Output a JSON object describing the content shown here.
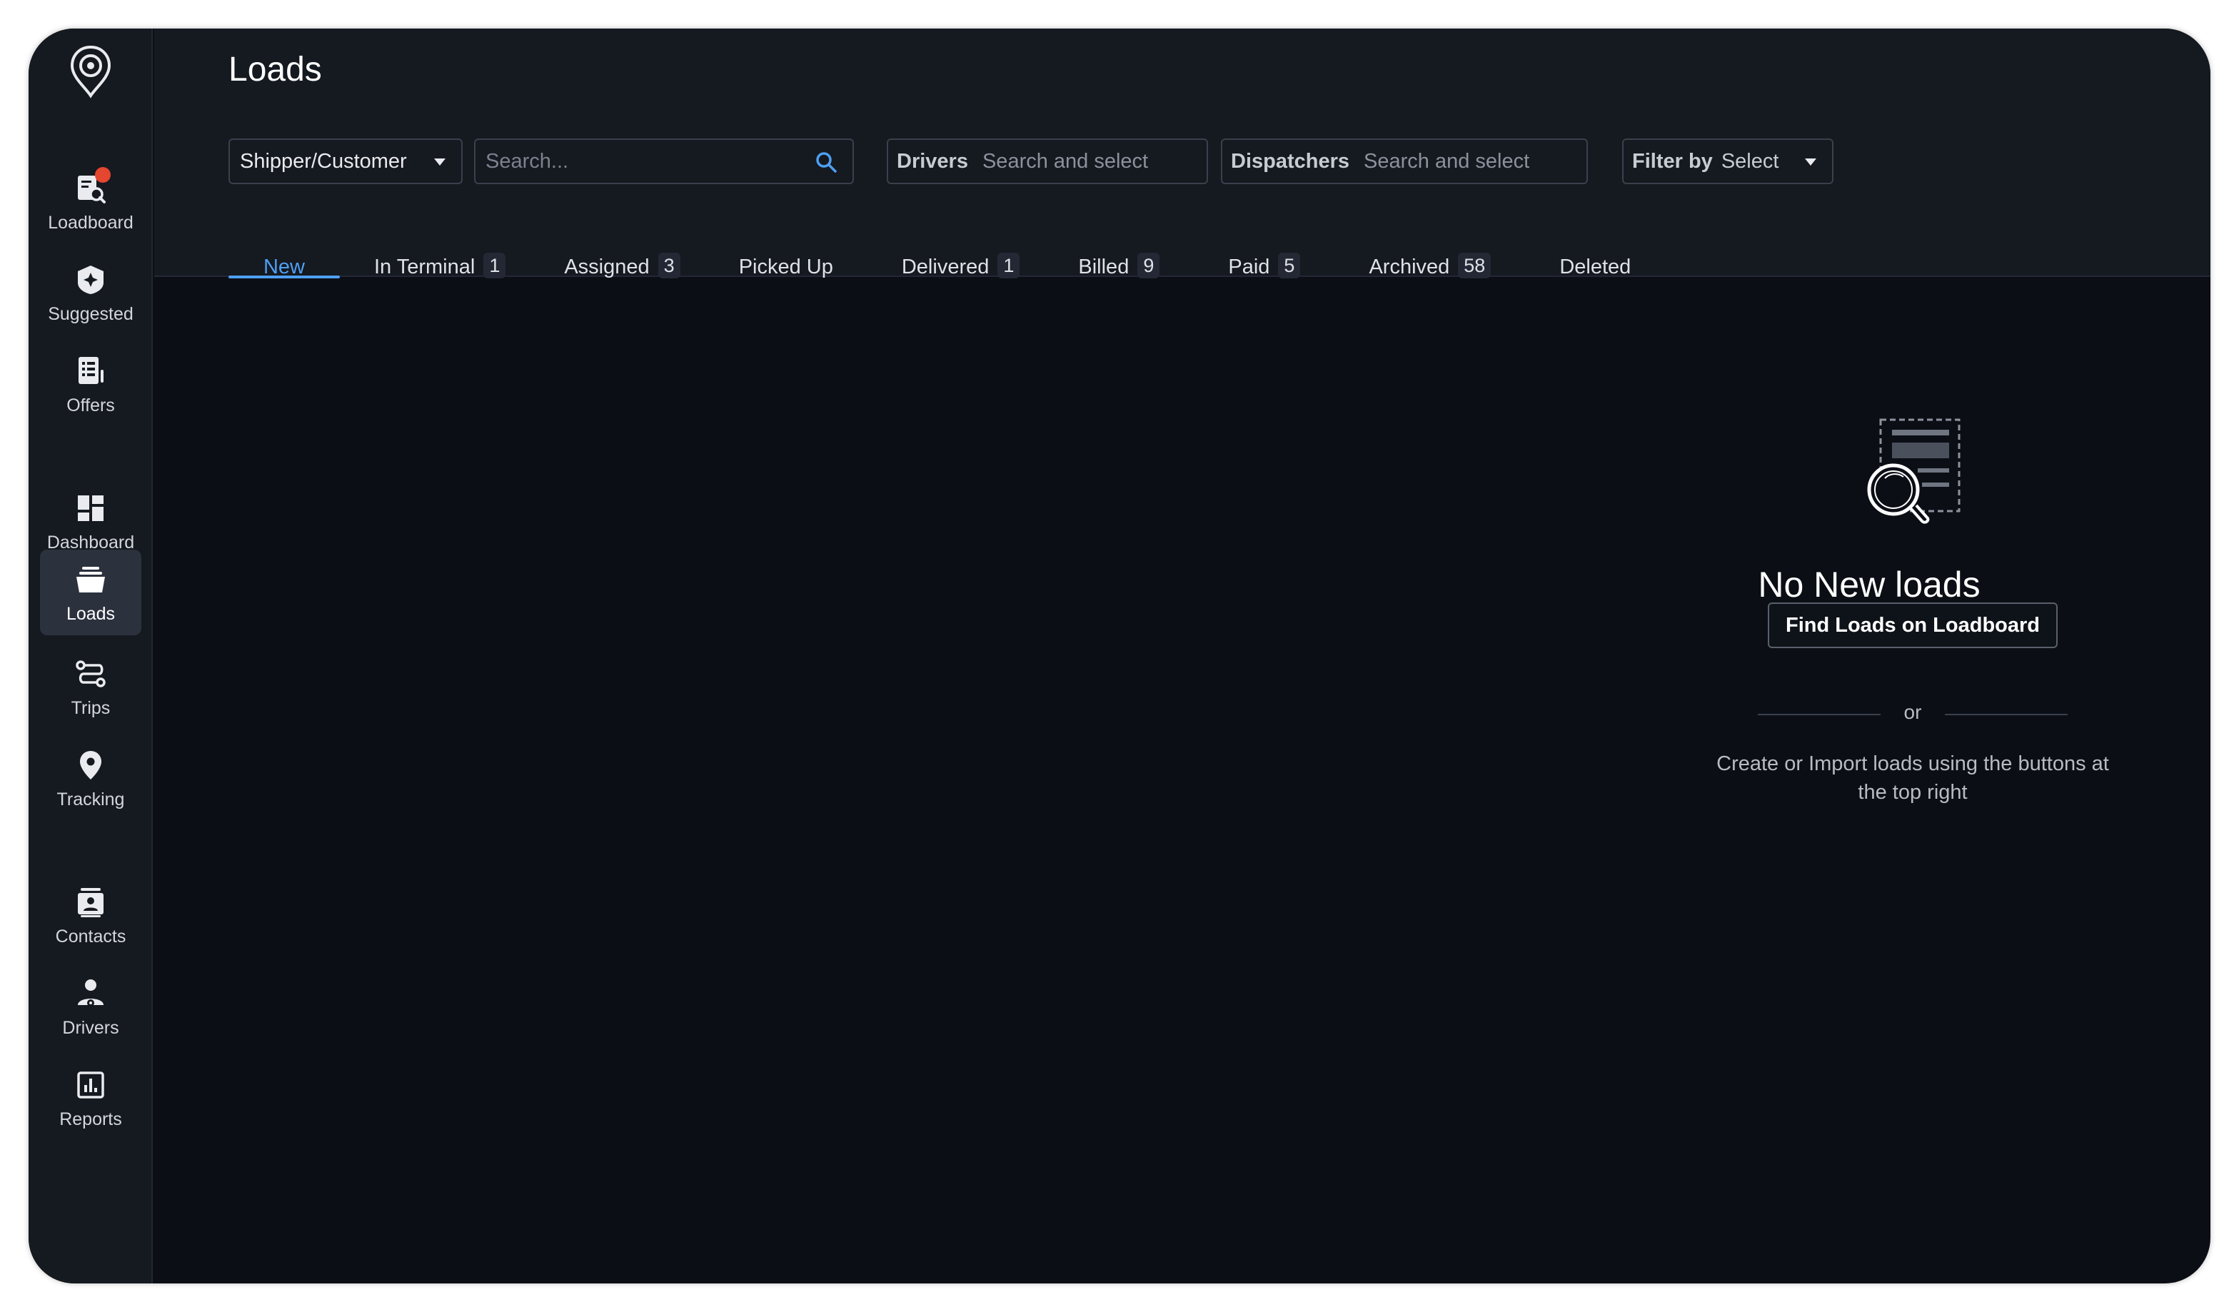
{
  "page": {
    "title": "Loads"
  },
  "sidebar": {
    "items": [
      {
        "label": "Loadboard",
        "icon": "loadboard-search-icon",
        "has_notification": true
      },
      {
        "label": "Suggested",
        "icon": "suggested-sparkle-icon"
      },
      {
        "label": "Offers",
        "icon": "offers-document-icon"
      },
      {
        "label": "Dashboard",
        "icon": "dashboard-grid-icon"
      },
      {
        "label": "Loads",
        "icon": "loads-stack-icon",
        "active": true
      },
      {
        "label": "Trips",
        "icon": "trips-route-icon"
      },
      {
        "label": "Tracking",
        "icon": "tracking-pin-icon"
      },
      {
        "label": "Contacts",
        "icon": "contacts-card-icon"
      },
      {
        "label": "Drivers",
        "icon": "driver-person-icon"
      },
      {
        "label": "Reports",
        "icon": "reports-chart-icon"
      }
    ]
  },
  "filters": {
    "shipper_select": "Shipper/Customer",
    "search_placeholder": "Search...",
    "drivers": {
      "label": "Drivers",
      "placeholder": "Search and select"
    },
    "dispatchers": {
      "label": "Dispatchers",
      "placeholder": "Search and select"
    },
    "filter_by": {
      "label": "Filter by",
      "value": "Select"
    }
  },
  "tabs": [
    {
      "label": "New",
      "count": null,
      "active": true
    },
    {
      "label": "In Terminal",
      "count": "1"
    },
    {
      "label": "Assigned",
      "count": "3"
    },
    {
      "label": "Picked Up",
      "count": null
    },
    {
      "label": "Delivered",
      "count": "1"
    },
    {
      "label": "Billed",
      "count": "9"
    },
    {
      "label": "Paid",
      "count": "5"
    },
    {
      "label": "Archived",
      "count": "58"
    },
    {
      "label": "Deleted",
      "count": null
    }
  ],
  "empty_state": {
    "title": "No New loads",
    "button": "Find Loads on Loadboard",
    "divider": "or",
    "description": "Create or Import loads using the buttons at the top right"
  },
  "colors": {
    "accent": "#4e9ff2",
    "sidebar_bg": "#151920",
    "content_bg": "#0b0e15",
    "notification": "#e5462f"
  }
}
